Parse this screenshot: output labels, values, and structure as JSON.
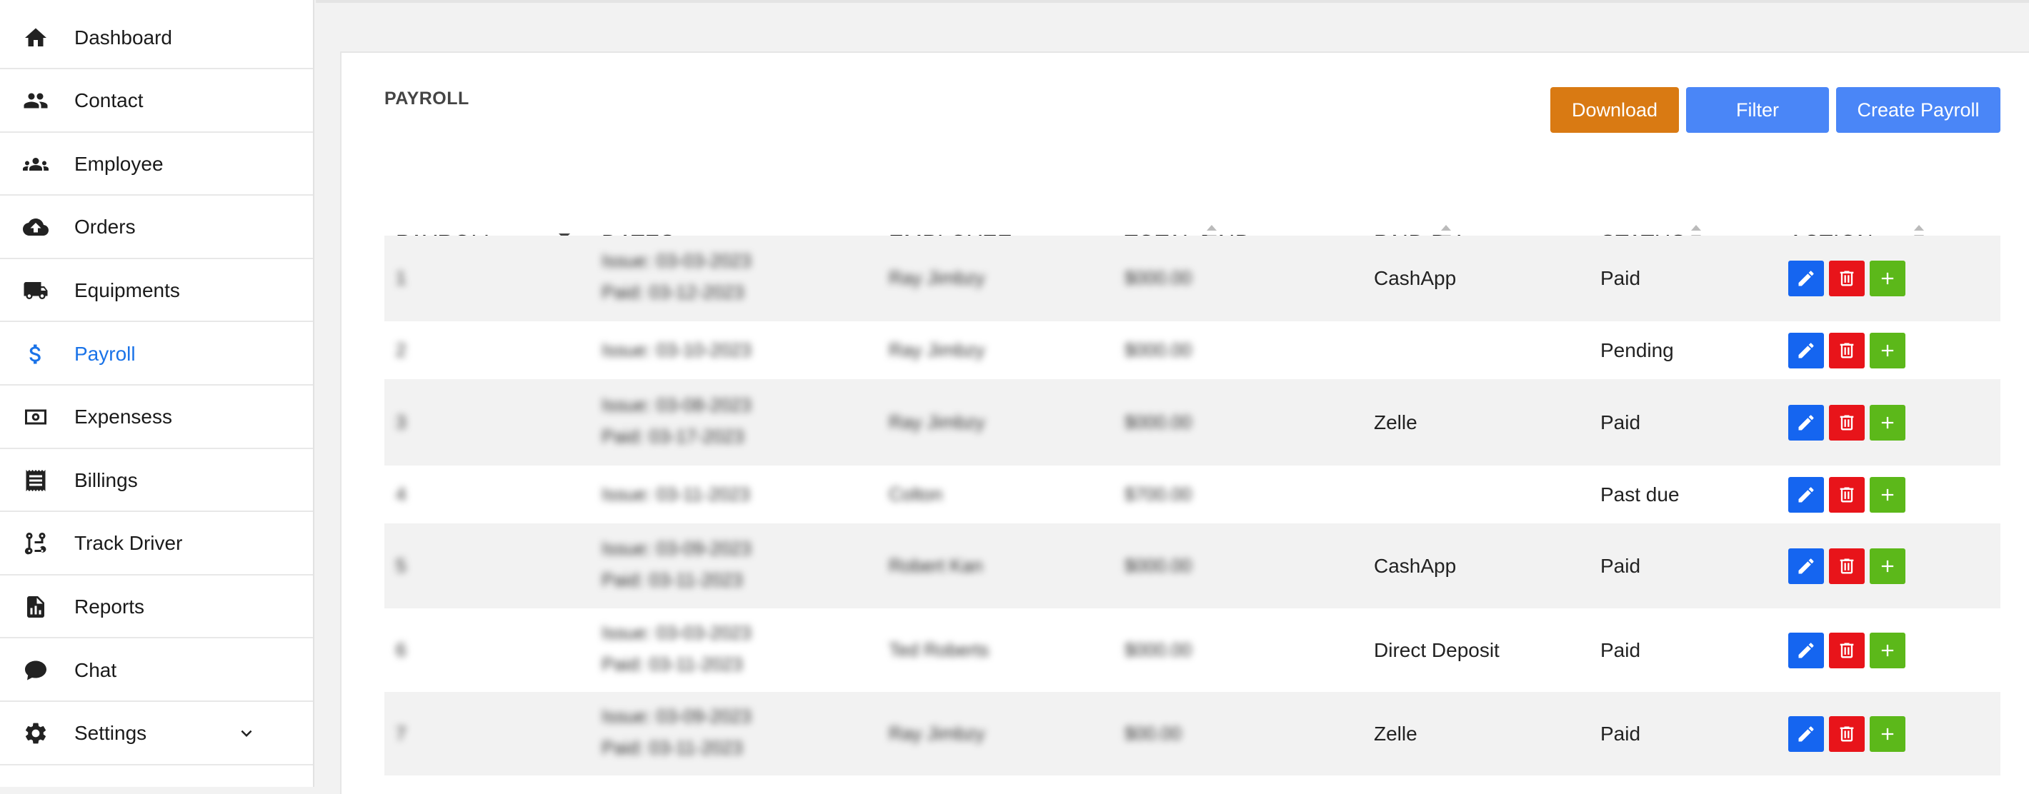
{
  "sidebar": {
    "items": [
      {
        "label": "Dashboard",
        "icon": "home-icon"
      },
      {
        "label": "Contact",
        "icon": "people-icon"
      },
      {
        "label": "Employee",
        "icon": "group-icon"
      },
      {
        "label": "Orders",
        "icon": "cloud-upload-icon"
      },
      {
        "label": "Equipments",
        "icon": "truck-icon"
      },
      {
        "label": "Payroll",
        "icon": "dollar-icon",
        "active": true
      },
      {
        "label": "Expensess",
        "icon": "cash-icon"
      },
      {
        "label": "Billings",
        "icon": "receipt-icon"
      },
      {
        "label": "Track Driver",
        "icon": "route-icon"
      },
      {
        "label": "Reports",
        "icon": "report-icon"
      },
      {
        "label": "Chat",
        "icon": "chat-icon"
      },
      {
        "label": "Settings",
        "icon": "gear-icon",
        "expandable": true
      }
    ]
  },
  "page": {
    "title": "PAYROLL",
    "buttons": {
      "download": "Download",
      "filter": "Filter",
      "create": "Create Payroll"
    }
  },
  "colors": {
    "active": "#1a73e8",
    "download": "#d97a13",
    "primary": "#4a86f7",
    "edit": "#1565f0",
    "delete": "#e8141a",
    "add": "#5cb81a"
  },
  "table": {
    "headers": [
      "PAYROLL",
      "DATES",
      "EMPLOYEE",
      "TOTAL PAID",
      "PAID BY",
      "STATUS",
      "ACTION"
    ],
    "rows": [
      {
        "id": "1",
        "dates": [
          "Issue: 03-03-2023",
          "Paid: 03-12-2023"
        ],
        "employee": "Ray Jimbzy",
        "total": "$000.00",
        "paid_by": "CashApp",
        "status": "Paid"
      },
      {
        "id": "2",
        "dates": [
          "Issue: 03-10-2023"
        ],
        "employee": "Ray Jimbzy",
        "total": "$000.00",
        "paid_by": "",
        "status": "Pending"
      },
      {
        "id": "3",
        "dates": [
          "Issue: 03-08-2023",
          "Paid: 03-17-2023"
        ],
        "employee": "Ray Jimbzy",
        "total": "$000.00",
        "paid_by": "Zelle",
        "status": "Paid"
      },
      {
        "id": "4",
        "dates": [
          "Issue: 03-11-2023"
        ],
        "employee": "Colton",
        "total": "$700.00",
        "paid_by": "",
        "status": "Past due"
      },
      {
        "id": "5",
        "dates": [
          "Issue: 03-09-2023",
          "Paid: 03-11-2023"
        ],
        "employee": "Robert Kan",
        "total": "$000.00",
        "paid_by": "CashApp",
        "status": "Paid"
      },
      {
        "id": "6",
        "dates": [
          "Issue: 03-03-2023",
          "Paid: 03-11-2023"
        ],
        "employee": "Ted Roberts",
        "total": "$000.00",
        "paid_by": "Direct Deposit",
        "status": "Paid"
      },
      {
        "id": "7",
        "dates": [
          "Issue: 03-09-2023",
          "Paid: 03-11-2023"
        ],
        "employee": "Ray Jimbzy",
        "total": "$00.00",
        "paid_by": "Zelle",
        "status": "Paid"
      }
    ]
  }
}
